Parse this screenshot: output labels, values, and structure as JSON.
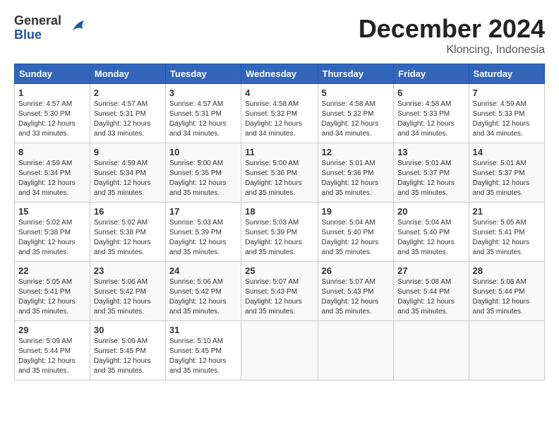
{
  "header": {
    "logo_general": "General",
    "logo_blue": "Blue",
    "month": "December 2024",
    "location": "Kloncing, Indonesia"
  },
  "weekdays": [
    "Sunday",
    "Monday",
    "Tuesday",
    "Wednesday",
    "Thursday",
    "Friday",
    "Saturday"
  ],
  "weeks": [
    [
      {
        "day": "1",
        "sunrise": "4:57 AM",
        "sunset": "5:30 PM",
        "daylight": "12 hours and 33 minutes."
      },
      {
        "day": "2",
        "sunrise": "4:57 AM",
        "sunset": "5:31 PM",
        "daylight": "12 hours and 33 minutes."
      },
      {
        "day": "3",
        "sunrise": "4:57 AM",
        "sunset": "5:31 PM",
        "daylight": "12 hours and 34 minutes."
      },
      {
        "day": "4",
        "sunrise": "4:58 AM",
        "sunset": "5:32 PM",
        "daylight": "12 hours and 34 minutes."
      },
      {
        "day": "5",
        "sunrise": "4:58 AM",
        "sunset": "5:32 PM",
        "daylight": "12 hours and 34 minutes."
      },
      {
        "day": "6",
        "sunrise": "4:58 AM",
        "sunset": "5:33 PM",
        "daylight": "12 hours and 34 minutes."
      },
      {
        "day": "7",
        "sunrise": "4:59 AM",
        "sunset": "5:33 PM",
        "daylight": "12 hours and 34 minutes."
      }
    ],
    [
      {
        "day": "8",
        "sunrise": "4:59 AM",
        "sunset": "5:34 PM",
        "daylight": "12 hours and 34 minutes."
      },
      {
        "day": "9",
        "sunrise": "4:59 AM",
        "sunset": "5:34 PM",
        "daylight": "12 hours and 35 minutes."
      },
      {
        "day": "10",
        "sunrise": "5:00 AM",
        "sunset": "5:35 PM",
        "daylight": "12 hours and 35 minutes."
      },
      {
        "day": "11",
        "sunrise": "5:00 AM",
        "sunset": "5:36 PM",
        "daylight": "12 hours and 35 minutes."
      },
      {
        "day": "12",
        "sunrise": "5:01 AM",
        "sunset": "5:36 PM",
        "daylight": "12 hours and 35 minutes."
      },
      {
        "day": "13",
        "sunrise": "5:01 AM",
        "sunset": "5:37 PM",
        "daylight": "12 hours and 35 minutes."
      },
      {
        "day": "14",
        "sunrise": "5:01 AM",
        "sunset": "5:37 PM",
        "daylight": "12 hours and 35 minutes."
      }
    ],
    [
      {
        "day": "15",
        "sunrise": "5:02 AM",
        "sunset": "5:38 PM",
        "daylight": "12 hours and 35 minutes."
      },
      {
        "day": "16",
        "sunrise": "5:02 AM",
        "sunset": "5:38 PM",
        "daylight": "12 hours and 35 minutes."
      },
      {
        "day": "17",
        "sunrise": "5:03 AM",
        "sunset": "5:39 PM",
        "daylight": "12 hours and 35 minutes."
      },
      {
        "day": "18",
        "sunrise": "5:03 AM",
        "sunset": "5:39 PM",
        "daylight": "12 hours and 35 minutes."
      },
      {
        "day": "19",
        "sunrise": "5:04 AM",
        "sunset": "5:40 PM",
        "daylight": "12 hours and 35 minutes."
      },
      {
        "day": "20",
        "sunrise": "5:04 AM",
        "sunset": "5:40 PM",
        "daylight": "12 hours and 35 minutes."
      },
      {
        "day": "21",
        "sunrise": "5:05 AM",
        "sunset": "5:41 PM",
        "daylight": "12 hours and 35 minutes."
      }
    ],
    [
      {
        "day": "22",
        "sunrise": "5:05 AM",
        "sunset": "5:41 PM",
        "daylight": "12 hours and 35 minutes."
      },
      {
        "day": "23",
        "sunrise": "5:06 AM",
        "sunset": "5:42 PM",
        "daylight": "12 hours and 35 minutes."
      },
      {
        "day": "24",
        "sunrise": "5:06 AM",
        "sunset": "5:42 PM",
        "daylight": "12 hours and 35 minutes."
      },
      {
        "day": "25",
        "sunrise": "5:07 AM",
        "sunset": "5:43 PM",
        "daylight": "12 hours and 35 minutes."
      },
      {
        "day": "26",
        "sunrise": "5:07 AM",
        "sunset": "5:43 PM",
        "daylight": "12 hours and 35 minutes."
      },
      {
        "day": "27",
        "sunrise": "5:08 AM",
        "sunset": "5:44 PM",
        "daylight": "12 hours and 35 minutes."
      },
      {
        "day": "28",
        "sunrise": "5:08 AM",
        "sunset": "5:44 PM",
        "daylight": "12 hours and 35 minutes."
      }
    ],
    [
      {
        "day": "29",
        "sunrise": "5:09 AM",
        "sunset": "5:44 PM",
        "daylight": "12 hours and 35 minutes."
      },
      {
        "day": "30",
        "sunrise": "5:09 AM",
        "sunset": "5:45 PM",
        "daylight": "12 hours and 35 minutes."
      },
      {
        "day": "31",
        "sunrise": "5:10 AM",
        "sunset": "5:45 PM",
        "daylight": "12 hours and 35 minutes."
      },
      null,
      null,
      null,
      null
    ]
  ]
}
